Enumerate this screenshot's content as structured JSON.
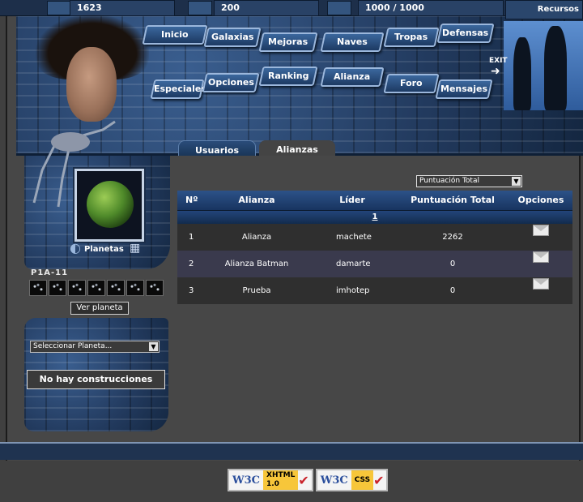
{
  "topbar": {
    "resource1": "1623",
    "resource2": "200",
    "resource3": "1000 / 1000",
    "recursos_label": "Recursos"
  },
  "nav": {
    "items": [
      "Inicio",
      "Galaxias",
      "Mejoras",
      "Naves",
      "Tropas",
      "Defensas",
      "Especiales",
      "Opciones",
      "Ranking",
      "Alianza",
      "Foro",
      "Mensajes"
    ],
    "exit_label": "EXIT"
  },
  "sidebar": {
    "planetas_label": "Planetas",
    "coord_label": "P1A-11",
    "ver_planeta_label": "Ver planeta",
    "select_planet_value": "Seleccionar Planeta...",
    "no_construcciones_label": "No hay construcciones"
  },
  "tabs": {
    "usuarios": "Usuarios",
    "alianzas": "Alianzas"
  },
  "sort_select": {
    "value": "Puntuación Total"
  },
  "table": {
    "headers": [
      "Nº",
      "Alianza",
      "Líder",
      "Puntuación Total",
      "Opciones"
    ],
    "page": "1",
    "rows": [
      {
        "n": "1",
        "alianza": "Alianza",
        "lider": "machete",
        "puntuacion": "2262"
      },
      {
        "n": "2",
        "alianza": "Alianza Batman",
        "lider": "damarte",
        "puntuacion": "0"
      },
      {
        "n": "3",
        "alianza": "Prueba",
        "lider": "imhotep",
        "puntuacion": "0"
      }
    ]
  },
  "footer": {
    "badge1_text": "XHTML\n1.0",
    "badge2_text": "CSS",
    "w3c": "W3C"
  },
  "colors": {
    "accent": "#2c5288",
    "panel": "#474747"
  }
}
